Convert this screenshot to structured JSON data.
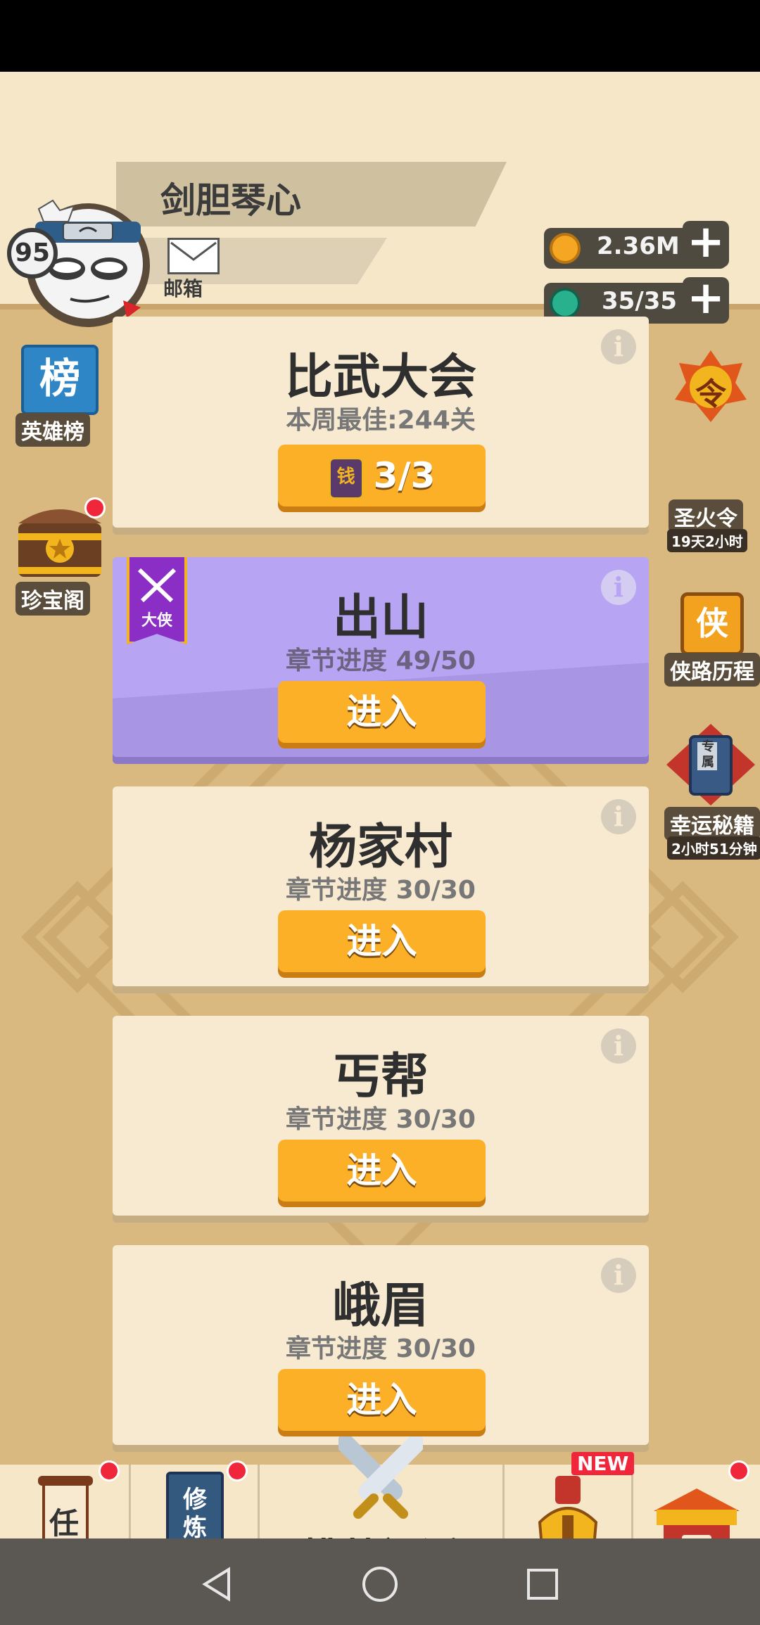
{
  "player": {
    "name": "剑胆琴心",
    "level": "95",
    "mail_label": "邮箱"
  },
  "resources": [
    {
      "icon": "coin-icon",
      "value": "2.36M"
    },
    {
      "icon": "stamina-icon",
      "value": "35/35"
    }
  ],
  "left_side": [
    {
      "icon_text": "榜",
      "label": "英雄榜"
    },
    {
      "label": "珍宝阁",
      "notification": true
    }
  ],
  "right_side": [
    {
      "icon_text": "令",
      "label": "圣火令",
      "timer": "19天2小时"
    },
    {
      "icon_text": "侠",
      "label": "侠路历程"
    },
    {
      "icon_text": "专属",
      "label": "幸运秘籍",
      "timer": "2小时51分钟"
    }
  ],
  "cards": [
    {
      "title": "比武大会",
      "subtitle": "本周最佳:244关",
      "button": "3/3",
      "button_icon_text": "钱"
    },
    {
      "title": "出山",
      "subtitle": "章节进度 49/50",
      "button": "进入",
      "badge": "大侠",
      "highlighted": true
    },
    {
      "title": "杨家村",
      "subtitle": "章节进度 30/30",
      "button": "进入"
    },
    {
      "title": "丐帮",
      "subtitle": "章节进度 30/30",
      "button": "进入"
    },
    {
      "title": "峨眉",
      "subtitle": "章节进度 30/30",
      "button": "进入"
    }
  ],
  "nav": {
    "task_icon_text": "任",
    "train_icon_text": "修炼",
    "center_label": "挑战门派",
    "new_badge": "NEW",
    "collect_icon_text": "收"
  },
  "colors": {
    "accent": "#fbb028",
    "highlight": "#b7a4f2",
    "card": "#f7ead0",
    "background": "#d9b97f"
  }
}
